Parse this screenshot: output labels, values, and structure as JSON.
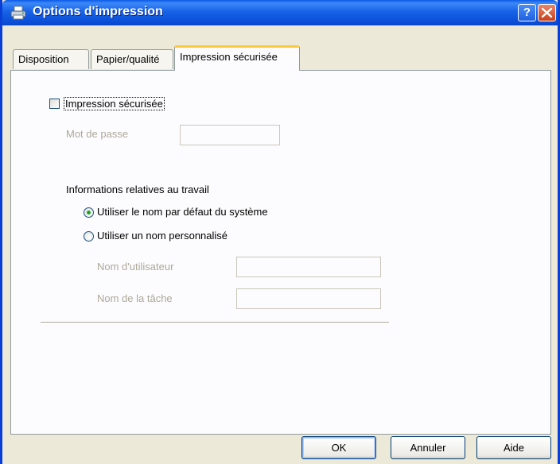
{
  "window": {
    "title": "Options d'impression",
    "icon": "printer-icon"
  },
  "titlebar_buttons": {
    "help_icon": "help-icon",
    "help_label": "?",
    "close_icon": "close-icon"
  },
  "tabs": [
    {
      "label": "Disposition",
      "active": false
    },
    {
      "label": "Papier/qualité",
      "active": false
    },
    {
      "label": "Impression sécurisée",
      "active": true
    }
  ],
  "secure_print": {
    "checkbox_label": "Impression sécurisée",
    "checked": false,
    "password_label": "Mot de passe",
    "password_value": ""
  },
  "job_info": {
    "heading": "Informations relatives au travail",
    "option_default": "Utiliser le nom par défaut du système",
    "option_custom": "Utiliser un nom personnalisé",
    "selected": "default",
    "username_label": "Nom d'utilisateur",
    "username_value": "",
    "jobname_label": "Nom de la tâche",
    "jobname_value": ""
  },
  "buttons": {
    "ok": "OK",
    "cancel": "Annuler",
    "help": "Aide"
  },
  "colors": {
    "titlebar": "#0b4fd7",
    "dialog_bg": "#ece9d8",
    "active_tab_accent": "#ffc73c",
    "radio_selected": "#21a121"
  }
}
